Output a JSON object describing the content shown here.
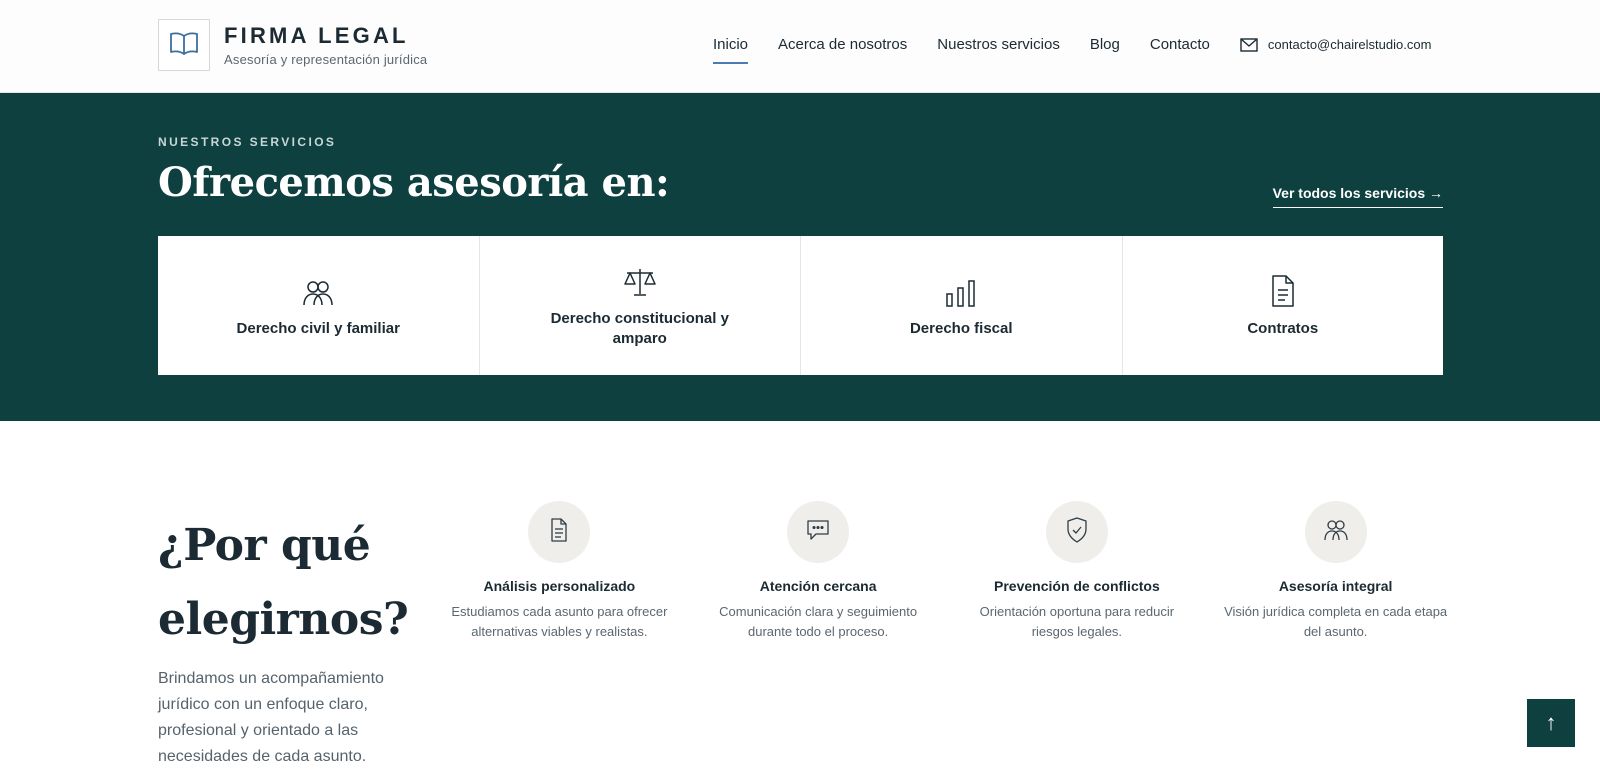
{
  "header": {
    "brand_name": "FIRMA LEGAL",
    "brand_tagline": "Asesoría y representación jurídica",
    "logo_icon": "open-book-icon",
    "nav": [
      {
        "label": "Inicio",
        "active": true
      },
      {
        "label": "Acerca de nosotros",
        "active": false
      },
      {
        "label": "Nuestros servicios",
        "active": false
      },
      {
        "label": "Blog",
        "active": false
      },
      {
        "label": "Contacto",
        "active": false
      }
    ],
    "email": "contacto@chairelstudio.com",
    "email_icon": "mail-icon"
  },
  "services": {
    "eyebrow": "NUESTROS SERVICIOS",
    "title": "Ofrecemos asesoría en:",
    "see_all": "Ver todos los servicios →",
    "cards": [
      {
        "label": "Derecho civil y familiar",
        "icon": "people-icon"
      },
      {
        "label": "Derecho constitucional y amparo",
        "icon": "scales-icon"
      },
      {
        "label": "Derecho fiscal",
        "icon": "bar-chart-icon"
      },
      {
        "label": "Contratos",
        "icon": "document-icon"
      }
    ]
  },
  "why": {
    "title": "¿Por qué elegirnos?",
    "text": "Brindamos un acompañamiento jurídico con un enfoque claro, profesional y orientado a las necesidades de cada asunto.",
    "features": [
      {
        "title": "Análisis personalizado",
        "desc": "Estudiamos cada asunto para ofrecer alternativas viables y realistas.",
        "icon": "document-icon"
      },
      {
        "title": "Atención cercana",
        "desc": "Comunicación clara y seguimiento durante todo el proceso.",
        "icon": "chat-icon"
      },
      {
        "title": "Prevención de conflictos",
        "desc": "Orientación oportuna para reducir riesgos legales.",
        "icon": "shield-check-icon"
      },
      {
        "title": "Asesoría integral",
        "desc": "Visión jurídica completa en cada etapa del asunto.",
        "icon": "people-icon"
      }
    ]
  },
  "scroll_top": {
    "label": "↑",
    "icon": "arrow-up-icon"
  },
  "colors": {
    "primary": "#0e4040",
    "accent": "#4b7bb0",
    "text": "#1b2a33",
    "muted": "#5b6770",
    "circle_bg": "#efeeea"
  }
}
